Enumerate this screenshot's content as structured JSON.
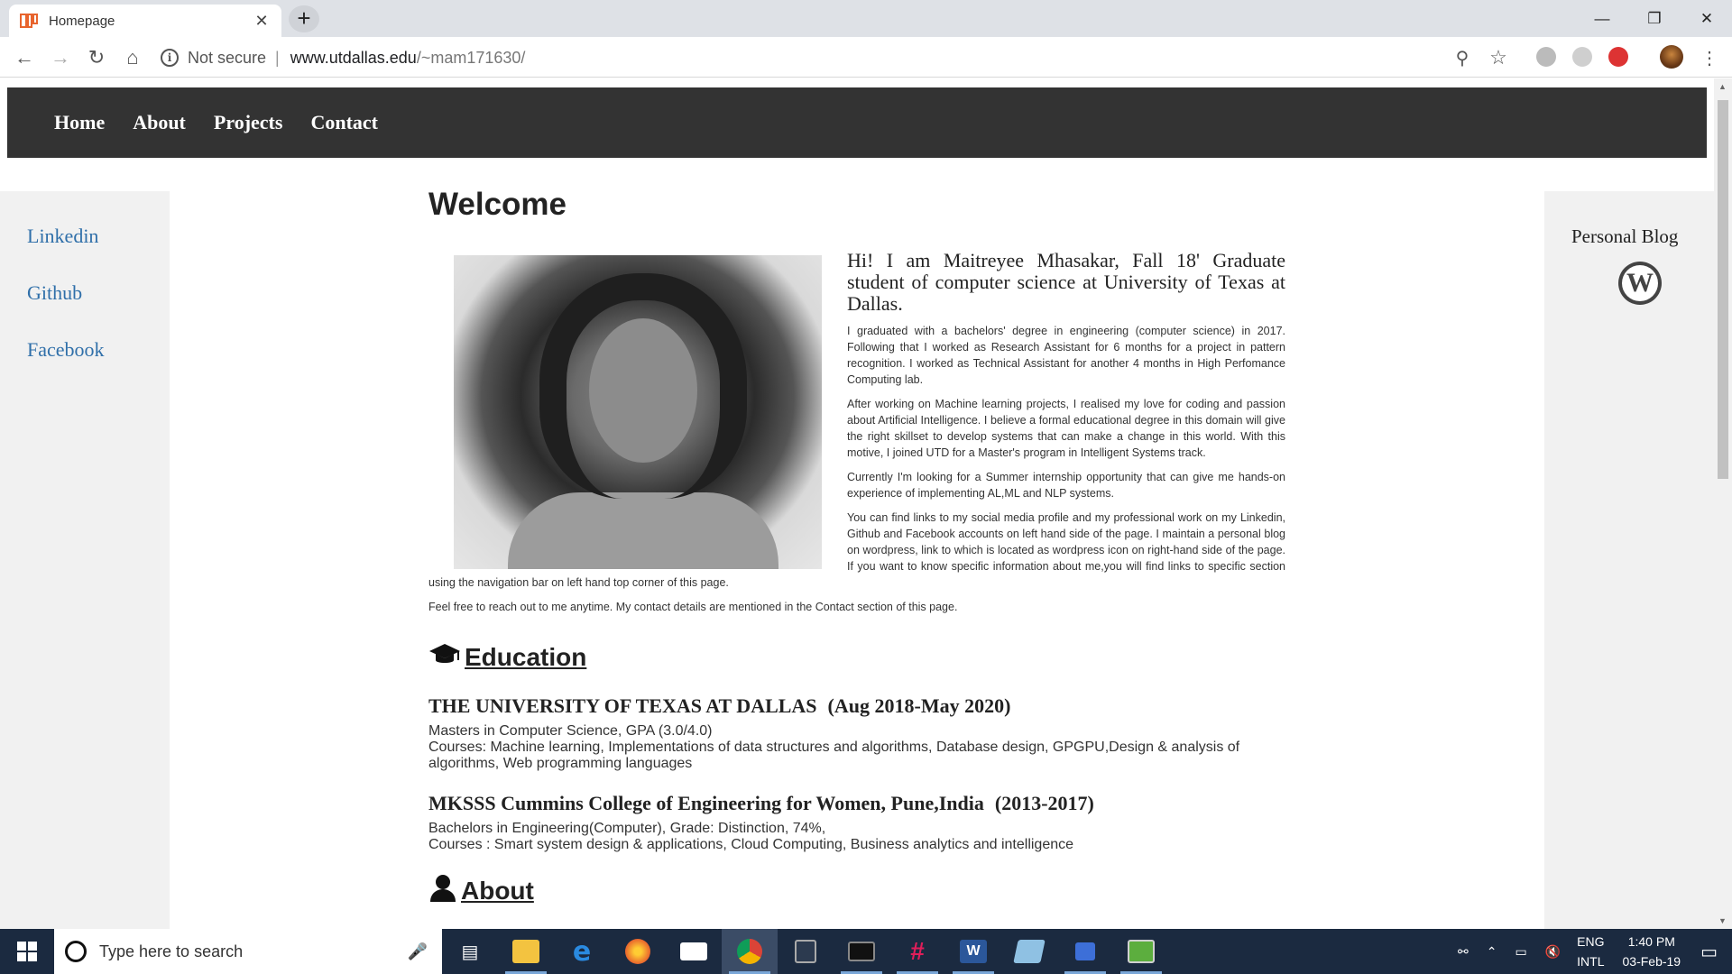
{
  "browser": {
    "tab_title": "Homepage",
    "not_secure": "Not secure",
    "url_host": "www.utdallas.edu",
    "url_path": "/~mam171630/"
  },
  "nav": {
    "items": [
      "Home",
      "About",
      "Projects",
      "Contact"
    ]
  },
  "left_links": [
    "Linkedin",
    "Github",
    "Facebook"
  ],
  "right": {
    "personal_blog": "Personal Blog",
    "wp_glyph": "W"
  },
  "main": {
    "heading": "Welcome",
    "intro": "Hi! I am Maitreyee Mhasakar, Fall 18' Graduate student of computer science at University of Texas at Dallas.",
    "paragraphs": [
      "I graduated with a bachelors' degree in engineering (computer science) in 2017. Following that I worked as Research Assistant for 6 months for a project in pattern recognition. I worked as Technical Assistant for another 4 months in High Perfomance Computing lab.",
      "After working on Machine learning projects, I realised my love for coding and passion about Artificial Intelligence. I believe a formal educational degree in this domain will give the right skillset to develop systems that can make a change in this world. With this motive, I joined UTD for a Master's program in Intelligent Systems track.",
      "Currently I'm looking for a Summer internship opportunity that can give me hands-on experience of implementing AL,ML and NLP systems.",
      "You can find links to my social media profile and my professional work on my Linkedin, Github and Facebook accounts on left hand side of the page. I maintain a personal blog on wordpress, link to which is located as wordpress icon on right-hand side of the page. If you want to know specific information about me,you will find links to specific section using the navigation bar on left hand top corner of this page.",
      "Feel free to reach out to me anytime. My contact details are mentioned in the Contact section of this page."
    ],
    "education": {
      "title": "Education",
      "entries": [
        {
          "school": "THE UNIVERSITY OF TEXAS AT DALLAS",
          "dates": "(Aug 2018-May 2020)",
          "line1": "Masters in Computer Science, GPA (3.0/4.0)",
          "line2": "Courses: Machine learning, Implementations of data structures and algorithms, Database design, GPGPU,Design & analysis of algorithms, Web programming languages"
        },
        {
          "school": "MKSSS Cummins College of Engineering for Women, Pune,India",
          "dates": "(2013-2017)",
          "line1": "Bachelors in Engineering(Computer), Grade: Distinction, 74%,",
          "line2": "Courses : Smart system design & applications, Cloud Computing, Business analytics and intelligence"
        }
      ]
    },
    "about_title": "About"
  },
  "taskbar": {
    "search_placeholder": "Type here to search",
    "lang1": "ENG",
    "lang2": "INTL",
    "time": "1:40 PM",
    "date": "03-Feb-19"
  },
  "icons": {
    "graduation": "graduation-cap-icon",
    "user": "user-icon"
  }
}
